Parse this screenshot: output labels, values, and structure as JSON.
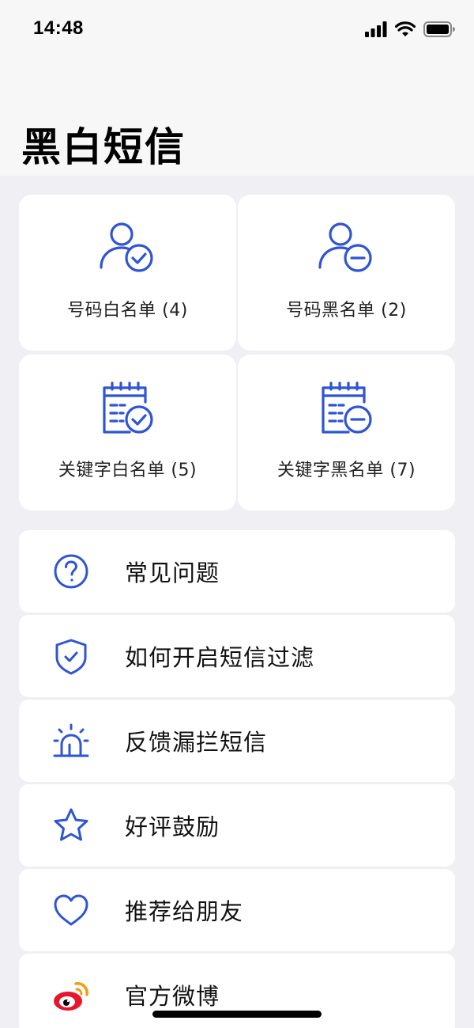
{
  "status_bar": {
    "time": "14:48"
  },
  "page": {
    "title": "黑白短信"
  },
  "cards": [
    {
      "label": "号码白名单 (4)",
      "icon": "user-check-icon"
    },
    {
      "label": "号码黑名单 (2)",
      "icon": "user-block-icon"
    },
    {
      "label": "关键字白名单 (5)",
      "icon": "keyword-check-icon"
    },
    {
      "label": "关键字黑名单 (7)",
      "icon": "keyword-block-icon"
    }
  ],
  "menu": [
    {
      "label": "常见问题",
      "icon": "question-icon"
    },
    {
      "label": "如何开启短信过滤",
      "icon": "shield-check-icon"
    },
    {
      "label": "反馈漏拦短信",
      "icon": "alarm-light-icon"
    },
    {
      "label": "好评鼓励",
      "icon": "star-icon"
    },
    {
      "label": "推荐给朋友",
      "icon": "heart-icon"
    },
    {
      "label": "官方微博",
      "icon": "weibo-icon"
    }
  ],
  "colors": {
    "accent": "#2f55d4",
    "background": "#efeff4",
    "card": "#ffffff"
  }
}
